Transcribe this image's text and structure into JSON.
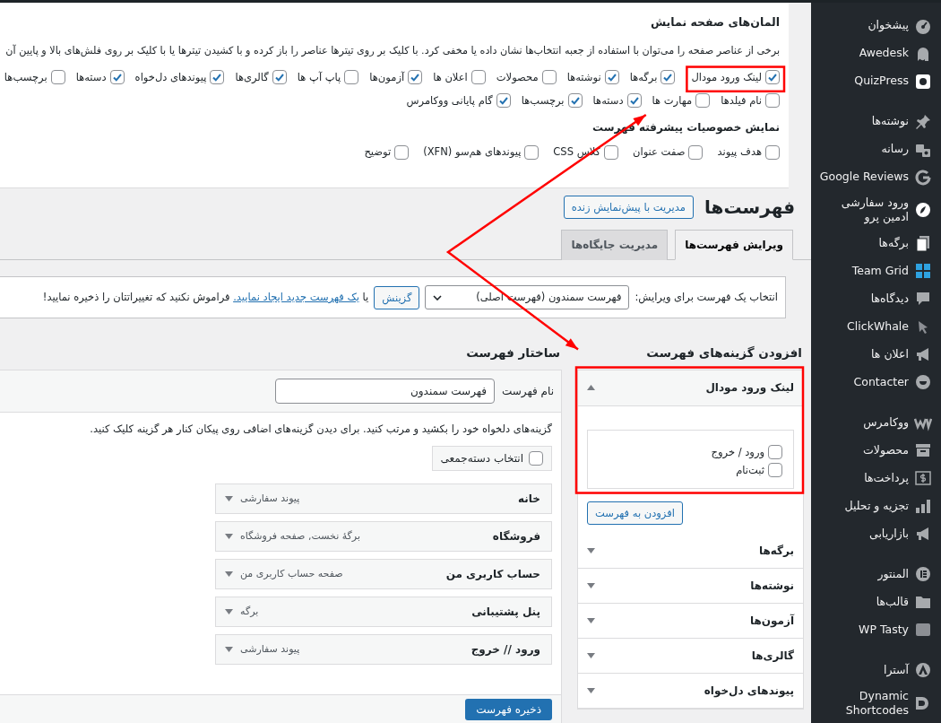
{
  "screen_options": {
    "title": "المان‌های صفحه نمایش",
    "description": "برخی از عناصر صفحه را می‌توان با استفاده از جعبه انتخاب‌ها نشان داده یا مخفی کرد. با کلیک بر روی تیترها عناصر را باز کرده و با کشیدن تیترها یا با کلیک بر روی فلش‌های بالا و پایین آن",
    "box_rows": [
      [
        {
          "label": "لینک ورود مودال",
          "checked": true
        },
        {
          "label": "برگه‌ها",
          "checked": true
        },
        {
          "label": "نوشته‌ها",
          "checked": true
        },
        {
          "label": "محصولات",
          "checked": false
        },
        {
          "label": "اعلان ها",
          "checked": false
        },
        {
          "label": "آزمون‌ها",
          "checked": true
        },
        {
          "label": "پاپ آپ ها",
          "checked": false
        },
        {
          "label": "گالری‌ها",
          "checked": true
        },
        {
          "label": "پیوندهای دل‌خواه",
          "checked": true
        },
        {
          "label": "دسته‌ها",
          "checked": true
        },
        {
          "label": "برچسب‌ها",
          "checked": false
        }
      ],
      [
        {
          "label": "نام فیلدها",
          "checked": false
        },
        {
          "label": "مهارت ها",
          "checked": false
        },
        {
          "label": "دسته‌ها",
          "checked": true
        },
        {
          "label": "برچسب‌ها",
          "checked": true
        },
        {
          "label": "گام پایانی ووکامرس",
          "checked": true
        }
      ]
    ],
    "advanced_title": "نمایش خصوصیات پیشرفته فهرست",
    "advanced_boxes": [
      {
        "label": "هدف پیوند",
        "checked": false
      },
      {
        "label": "صفت عنوان",
        "checked": false
      },
      {
        "label": "کلاس CSS",
        "checked": false
      },
      {
        "label": "پیوندهای هم‌سو (XFN)",
        "checked": false
      },
      {
        "label": "توضیح",
        "checked": false
      }
    ]
  },
  "page_title": "فهرست‌ها",
  "live_preview_button": "مدیریت با پیش‌نمایش زنده",
  "tabs": [
    {
      "label": "ویرایش فهرست‌ها",
      "selected": true
    },
    {
      "label": "مدیریت جایگاه‌ها",
      "selected": false
    }
  ],
  "menu_select_bar": {
    "label": "انتخاب یک فهرست برای ویرایش:",
    "select_value": "فهرست سمندون (فهرست اصلی)",
    "select_button": "گزینش",
    "hint_before": "یا",
    "hint_link": "یک فهرست جدید ایجاد نمایید.",
    "hint_after": "فراموش نکنید که تغییراتتان را ذخیره نمایید!"
  },
  "add_items": {
    "title": "افزودن گزینه‌های فهرست",
    "sections": [
      {
        "title": "لینک ورود مودال",
        "expanded": true,
        "options": [
          {
            "label": "ورود / خروج",
            "checked": false
          },
          {
            "label": "ثبت‌نام",
            "checked": false
          }
        ],
        "button": "افزودن به فهرست"
      },
      {
        "title": "برگه‌ها",
        "expanded": false
      },
      {
        "title": "نوشته‌ها",
        "expanded": false
      },
      {
        "title": "آزمون‌ها",
        "expanded": false
      },
      {
        "title": "گالری‌ها",
        "expanded": false
      },
      {
        "title": "پیوندهای دل‌خواه",
        "expanded": false
      }
    ]
  },
  "structure": {
    "title": "ساختار فهرست",
    "name_label": "نام فهرست",
    "name_value": "فهرست سمندون",
    "instructions": "گزینه‌های دلخواه خود را بکشید و مرتب کنید. برای دیدن گزینه‌های اضافی روی پیکان کنار هر گزینه کلیک کنید.",
    "bulk_select": {
      "label": "انتخاب دسته‌جمعی",
      "checked": false
    },
    "items": [
      {
        "title": "خانه",
        "type": "پیوند سفارشی"
      },
      {
        "title": "فروشگاه",
        "type": "برگهٔ نخست, صفحه فروشگاه"
      },
      {
        "title": "حساب کاربری من",
        "type": "صفحه حساب کاربری من"
      },
      {
        "title": "پنل پشتیبانی",
        "type": "برگه"
      },
      {
        "title": "ورود // خروج",
        "type": "پیوند سفارشی"
      }
    ],
    "save_button": "ذخیره فهرست"
  },
  "sidebar": {
    "groups": [
      [
        {
          "label": "پیشخوان"
        },
        {
          "label": "Awedesk"
        },
        {
          "label": "QuizPress"
        }
      ],
      [
        {
          "label": "نوشته‌ها"
        },
        {
          "label": "رسانه"
        },
        {
          "label": "Google Reviews"
        },
        {
          "label": "ورود سفارشی ادمین پرو"
        },
        {
          "label": "برگه‌ها"
        },
        {
          "label": "Team Grid"
        },
        {
          "label": "دیدگاه‌ها"
        },
        {
          "label": "ClickWhale"
        },
        {
          "label": "اعلان ها"
        },
        {
          "label": "Contacter"
        }
      ],
      [
        {
          "label": "ووکامرس"
        },
        {
          "label": "محصولات"
        },
        {
          "label": "پرداخت‌ها"
        },
        {
          "label": "تجزیه و تحلیل"
        },
        {
          "label": "بازاریابی"
        }
      ],
      [
        {
          "label": "المنتور"
        },
        {
          "label": "قالب‌ها"
        },
        {
          "label": "WP Tasty"
        }
      ],
      [
        {
          "label": "آسترا"
        },
        {
          "label": "Dynamic Shortcodes"
        }
      ]
    ]
  }
}
